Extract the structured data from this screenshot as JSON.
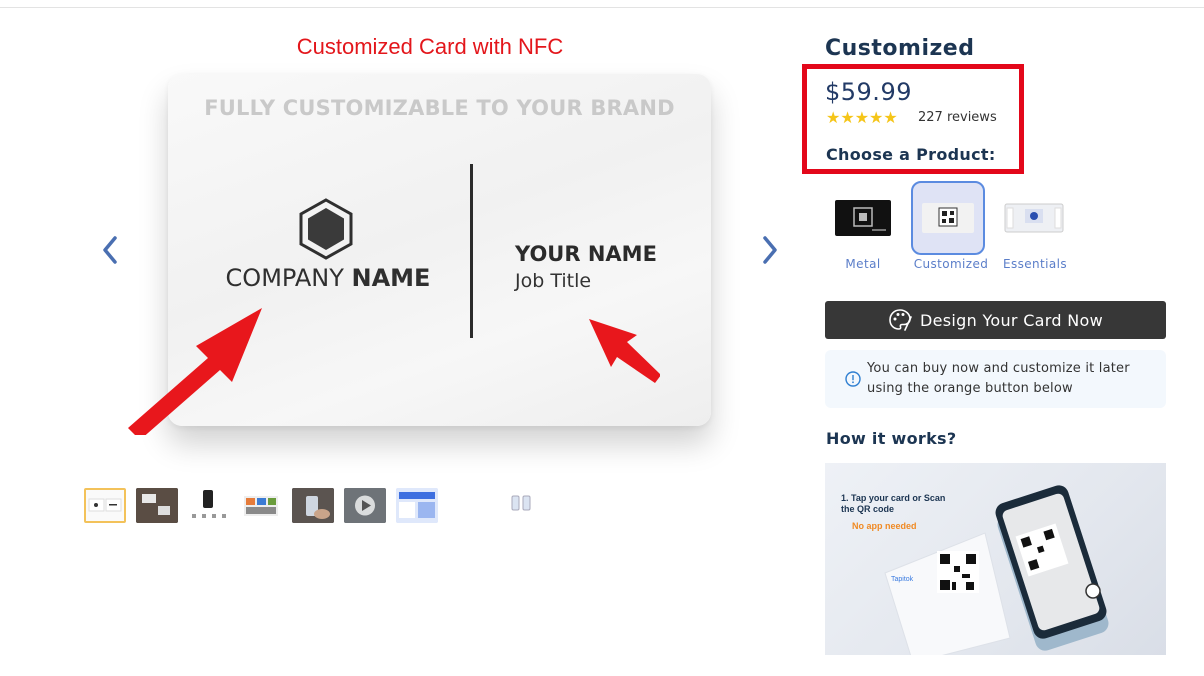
{
  "gallery": {
    "annotation_title": "Customized Card with NFC",
    "card": {
      "headline": "FULLY CUSTOMIZABLE TO YOUR BRAND",
      "company_regular": "COMPANY ",
      "company_bold": "NAME",
      "your_name": "YOUR NAME",
      "job_title": "Job Title"
    },
    "thumbnail_count": 9,
    "selected_thumbnail": 1
  },
  "product": {
    "title": "Customized",
    "price": "$59.99",
    "rating_stars": "★★★★★",
    "rating": 5,
    "reviews": "227 reviews",
    "choose_label": "Choose a Product:",
    "variants": [
      {
        "label": "Metal"
      },
      {
        "label": "Customized"
      },
      {
        "label": "Essentials"
      }
    ],
    "selected_variant": "Customized"
  },
  "actions": {
    "design_button": "Design Your Card Now",
    "info_text": "You can buy now and customize it later using the orange button below"
  },
  "how_it_works": {
    "heading": "How it works?",
    "step_text": "1. Tap your card or Scan the QR code",
    "step_note": "No app needed",
    "brand": "Tapitok"
  },
  "colors": {
    "accent_red": "#e3071a",
    "navy": "#1c3552",
    "star": "#f5c518",
    "variant_label": "#5b7ec9",
    "button_dark": "#373737"
  }
}
